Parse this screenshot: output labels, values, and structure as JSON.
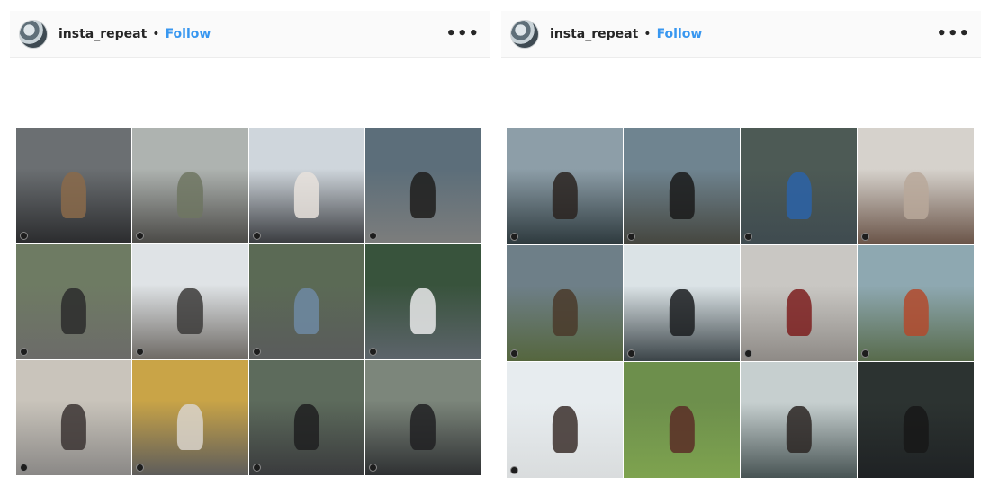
{
  "posts": [
    {
      "username": "insta_repeat",
      "separator": "•",
      "follow_label": "Follow",
      "more_label": "•••",
      "tiles": [
        {
          "top": "#6b6f72",
          "bottom": "#2b2c2e",
          "figure": "#8a6a4a"
        },
        {
          "top": "#aeb3b0",
          "bottom": "#4b4a47",
          "figure": "#6f7562"
        },
        {
          "top": "#cfd6dc",
          "bottom": "#3a3c40",
          "figure": "#e7e2dc"
        },
        {
          "top": "#5c6e7a",
          "bottom": "#7c7d7c",
          "figure": "#1f1d1c"
        },
        {
          "top": "#6e7b63",
          "bottom": "#6c6b69",
          "figure": "#2c2b2b"
        },
        {
          "top": "#dfe3e6",
          "bottom": "#6e6a65",
          "figure": "#3c3b3a"
        },
        {
          "top": "#5b6a55",
          "bottom": "#5a5b5c",
          "figure": "#6f8aa3"
        },
        {
          "top": "#38533c",
          "bottom": "#5d646b",
          "figure": "#e9e9ea"
        },
        {
          "top": "#c9c4bb",
          "bottom": "#8a8886",
          "figure": "#3b3433"
        },
        {
          "top": "#c9a447",
          "bottom": "#5e5d5b",
          "figure": "#d9d4cb"
        },
        {
          "top": "#5d6b5c",
          "bottom": "#3a3b3d",
          "figure": "#1e1e20"
        },
        {
          "top": "#7c867b",
          "bottom": "#2f3133",
          "figure": "#202022"
        }
      ]
    },
    {
      "username": "insta_repeat",
      "separator": "•",
      "follow_label": "Follow",
      "more_label": "•••",
      "tiles": [
        {
          "top": "#8d9ea8",
          "bottom": "#2e3a3e",
          "figure": "#2a2320"
        },
        {
          "top": "#6f8490",
          "bottom": "#45463f",
          "figure": "#1a1a1a"
        },
        {
          "top": "#4d5a55",
          "bottom": "#3f4b50",
          "figure": "#2b63a8"
        },
        {
          "top": "#d6d2cc",
          "bottom": "#6a5448",
          "figure": "#b8a89a"
        },
        {
          "top": "#6e7f88",
          "bottom": "#55663e",
          "figure": "#4a3a2a"
        },
        {
          "top": "#dbe3e6",
          "bottom": "#3b4448",
          "figure": "#1b1d20"
        },
        {
          "top": "#c9c7c3",
          "bottom": "#8e8a86",
          "figure": "#7c1f1f"
        },
        {
          "top": "#8ea8b1",
          "bottom": "#586b4c",
          "figure": "#b34a2d"
        },
        {
          "top": "#e7ecef",
          "bottom": "#d9dcdd",
          "figure": "#3b2f2b"
        },
        {
          "top": "#6d8f4c",
          "bottom": "#7ea34f",
          "figure": "#5b2d27"
        },
        {
          "top": "#c6cfcf",
          "bottom": "#485454",
          "figure": "#2b2623"
        },
        {
          "top": "#2c3331",
          "bottom": "#1f2224",
          "figure": "#171717"
        }
      ]
    }
  ]
}
